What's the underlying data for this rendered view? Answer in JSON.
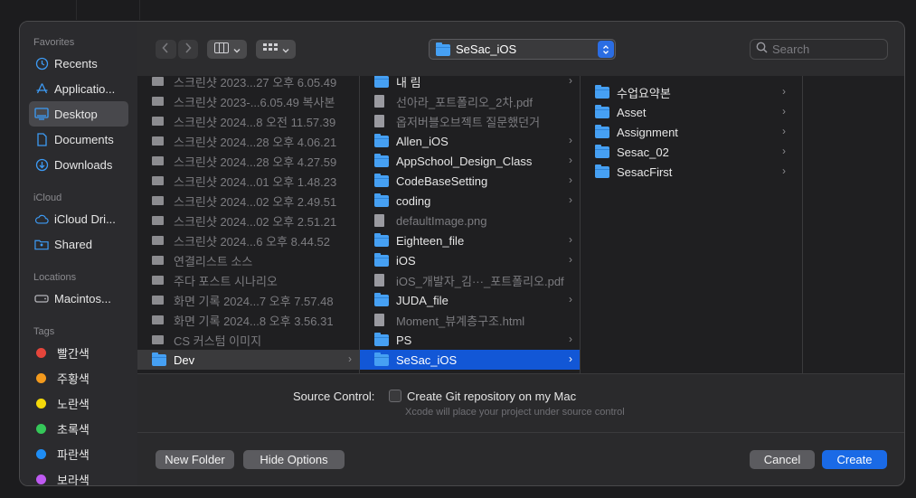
{
  "sidebar": {
    "favorites_header": "Favorites",
    "favorites": [
      {
        "label": "Recents",
        "icon": "clock-icon"
      },
      {
        "label": "Applicatio...",
        "icon": "apps-icon"
      },
      {
        "label": "Desktop",
        "icon": "desktop-icon",
        "selected": true
      },
      {
        "label": "Documents",
        "icon": "document-icon"
      },
      {
        "label": "Downloads",
        "icon": "download-icon"
      }
    ],
    "icloud_header": "iCloud",
    "icloud": [
      {
        "label": "iCloud Dri...",
        "icon": "cloud-icon"
      },
      {
        "label": "Shared",
        "icon": "shared-folder-icon"
      }
    ],
    "locations_header": "Locations",
    "locations": [
      {
        "label": "Macintos...",
        "icon": "disk-icon"
      }
    ],
    "tags_header": "Tags",
    "tags": [
      {
        "label": "빨간색",
        "color": "#e5453b"
      },
      {
        "label": "주황색",
        "color": "#f39a1d"
      },
      {
        "label": "노란색",
        "color": "#f5d90a"
      },
      {
        "label": "초록색",
        "color": "#35c759"
      },
      {
        "label": "파란색",
        "color": "#1e8df5"
      },
      {
        "label": "보라색",
        "color": "#bf5af2"
      }
    ]
  },
  "toolbar": {
    "back_icon": "chevron-left-icon",
    "forward_icon": "chevron-right-icon",
    "view_icon": "column-view-icon",
    "group_icon": "grid-view-icon",
    "location": "SeSac_iOS",
    "search_placeholder": "Search"
  },
  "columns": {
    "col1": [
      {
        "label": "스크린샷 2023...27 오후 6.05.49",
        "kind": "thumb",
        "dim": true
      },
      {
        "label": "스크린샷 2023-...6.05.49 복사본",
        "kind": "thumb",
        "dim": true
      },
      {
        "label": "스크린샷 2024...8 오전 11.57.39",
        "kind": "thumb",
        "dim": true
      },
      {
        "label": "스크린샷 2024...28 오후 4.06.21",
        "kind": "thumb",
        "dim": true
      },
      {
        "label": "스크린샷 2024...28 오후 4.27.59",
        "kind": "thumb",
        "dim": true
      },
      {
        "label": "스크린샷 2024...01 오후 1.48.23",
        "kind": "thumb",
        "dim": true
      },
      {
        "label": "스크린샷 2024...02 오후 2.49.51",
        "kind": "thumb",
        "dim": true
      },
      {
        "label": "스크린샷 2024...02 오후 2.51.21",
        "kind": "thumb",
        "dim": true
      },
      {
        "label": "스크린샷 2024...6 오후 8.44.52",
        "kind": "thumb",
        "dim": true
      },
      {
        "label": "연결리스트 소스",
        "kind": "thumb",
        "dim": true
      },
      {
        "label": "주다 포스트 시나리오",
        "kind": "thumb",
        "dim": true
      },
      {
        "label": "화면 기록 2024...7 오후 7.57.48",
        "kind": "thumb",
        "dim": true
      },
      {
        "label": "화면 기록 2024...8 오후 3.56.31",
        "kind": "thumb",
        "dim": true
      },
      {
        "label": "CS 커스텀 이미지",
        "kind": "thumb",
        "dim": true
      },
      {
        "label": "Dev",
        "kind": "folder",
        "state": "parent-sel",
        "chevron": "›"
      }
    ],
    "col2": [
      {
        "label": "내 림",
        "kind": "folder",
        "chevron": "›"
      },
      {
        "label": "선아라_포트폴리오_2차.pdf",
        "kind": "doc",
        "dim": true
      },
      {
        "label": "옵저버블오브젝트 질문했던거",
        "kind": "doc",
        "dim": true
      },
      {
        "label": "Allen_iOS",
        "kind": "folder",
        "chevron": "›"
      },
      {
        "label": "AppSchool_Design_Class",
        "kind": "folder",
        "chevron": "›"
      },
      {
        "label": "CodeBaseSetting",
        "kind": "folder",
        "chevron": "›"
      },
      {
        "label": "coding",
        "kind": "folder",
        "chevron": "›"
      },
      {
        "label": "defaultImage.png",
        "kind": "doc",
        "dim": true
      },
      {
        "label": "Eighteen_file",
        "kind": "folder",
        "chevron": "›"
      },
      {
        "label": "iOS",
        "kind": "folder",
        "chevron": "›"
      },
      {
        "label": "iOS_개발자_김···_포트폴리오.pdf",
        "kind": "doc",
        "dim": true
      },
      {
        "label": "JUDA_file",
        "kind": "folder",
        "chevron": "›"
      },
      {
        "label": "Moment_뷰계층구조.html",
        "kind": "doc",
        "dim": true
      },
      {
        "label": "PS",
        "kind": "folder",
        "chevron": "›"
      },
      {
        "label": "SeSac_iOS",
        "kind": "folder",
        "state": "sel",
        "chevron": "›"
      }
    ],
    "col3": [
      {
        "label": "수업요약본",
        "kind": "folder",
        "chevron": "›"
      },
      {
        "label": "Asset",
        "kind": "folder",
        "chevron": "›"
      },
      {
        "label": "Assignment",
        "kind": "folder",
        "chevron": "›"
      },
      {
        "label": "Sesac_02",
        "kind": "folder",
        "chevron": "›"
      },
      {
        "label": "SesacFirst",
        "kind": "folder",
        "chevron": "›"
      }
    ]
  },
  "options": {
    "source_control_label": "Source Control:",
    "git_checkbox_label": "Create Git repository on my Mac",
    "git_checked": false,
    "git_help": "Xcode will place your project under source control"
  },
  "buttons": {
    "new_folder": "New Folder",
    "hide_options": "Hide Options",
    "cancel": "Cancel",
    "create": "Create"
  }
}
